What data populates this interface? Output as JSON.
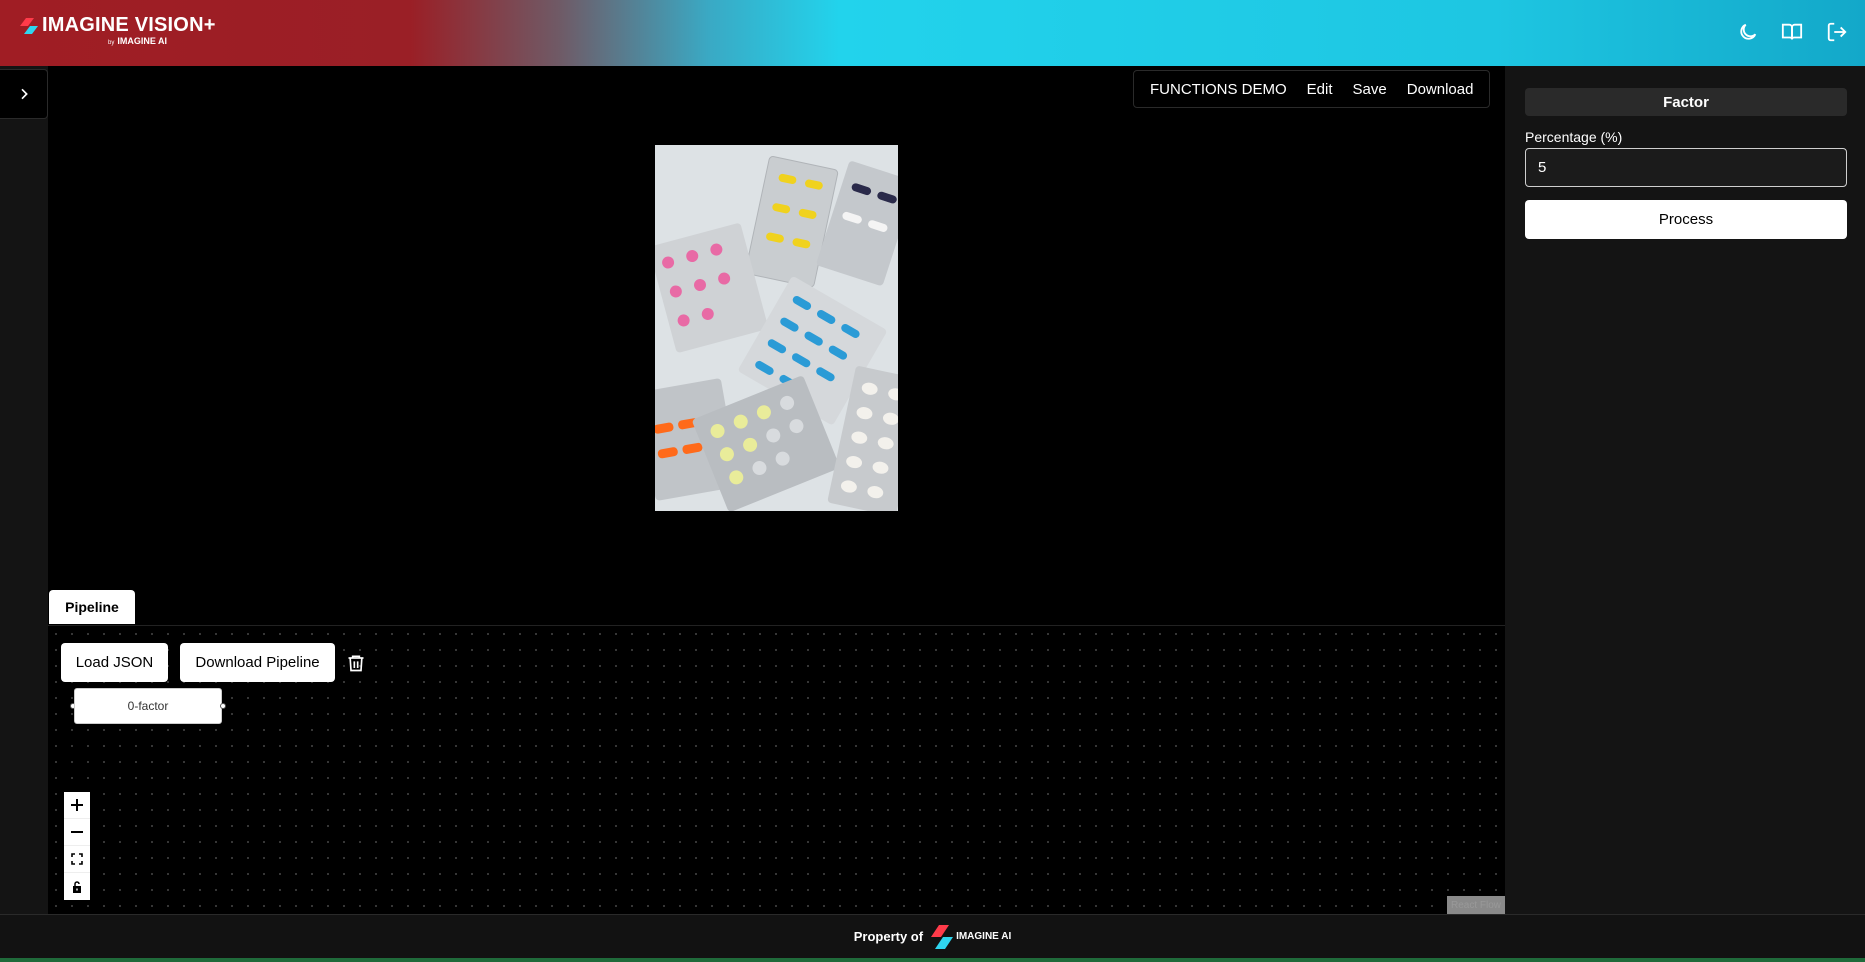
{
  "header": {
    "logo_text": "IMAGINE VISION+",
    "logo_by": "by",
    "logo_company": "IMAGINE AI",
    "icons": [
      "moon-icon",
      "book-icon",
      "logout-icon"
    ]
  },
  "toolbar": {
    "title": "FUNCTIONS DEMO",
    "edit_label": "Edit",
    "save_label": "Save",
    "download_label": "Download"
  },
  "pipeline": {
    "tab_label": "Pipeline",
    "load_json_label": "Load JSON",
    "download_pipeline_label": "Download Pipeline",
    "node_label": "0-factor",
    "attribution": "React Flow"
  },
  "panel": {
    "section_title": "Factor",
    "field_label": "Percentage (%)",
    "field_value": "5",
    "process_label": "Process"
  },
  "footer": {
    "text": "Property of",
    "company": "IMAGINE AI"
  },
  "colors": {
    "header_red": "#a01d24",
    "header_cyan": "#22d3ec",
    "panel_bg": "#141414"
  }
}
